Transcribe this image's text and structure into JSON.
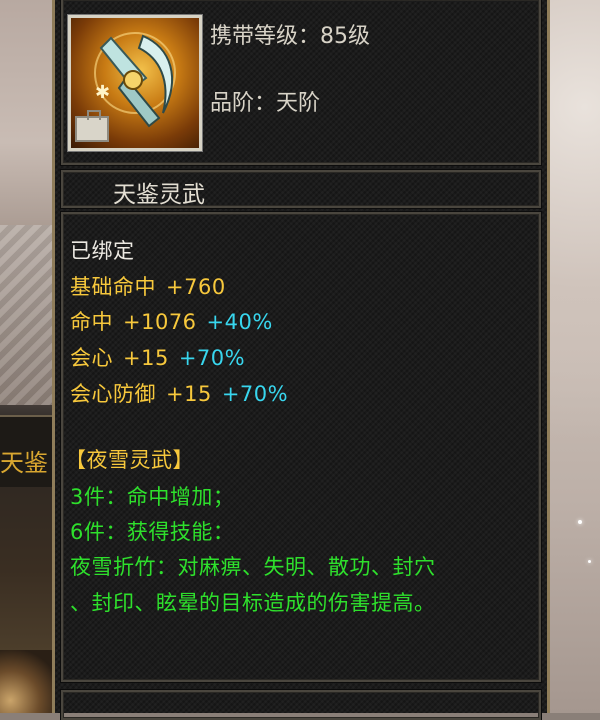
{
  "item": {
    "carry_level": "携带等级：85级",
    "grade": "品阶：天阶",
    "name": "天鉴灵武",
    "icon": "spirit-weapon-icon"
  },
  "attributes": {
    "bound": "已绑定",
    "stats": [
      {
        "label": "基础命中",
        "value": "+760",
        "bonus": ""
      },
      {
        "label": "命中",
        "value": "+1076",
        "bonus": "+40%"
      },
      {
        "label": "会心",
        "value": "+15",
        "bonus": "+70%"
      },
      {
        "label": "会心防御",
        "value": "+15",
        "bonus": "+70%"
      }
    ]
  },
  "set": {
    "title": "【夜雪灵武】",
    "piece3": "3件：命中增加；",
    "piece6": "6件：获得技能：",
    "skill_line1": "夜雪折竹：对麻痹、失明、散功、封穴",
    "skill_line2": "、封印、眩晕的目标造成的伤害提高。"
  },
  "background": {
    "left_banner_text": "天鉴"
  },
  "colors": {
    "white": "#ece9e2",
    "yellow": "#f7c83c",
    "cyan": "#38d6ee",
    "green": "#2ee02c",
    "gold_border": "#8f7d5a"
  }
}
